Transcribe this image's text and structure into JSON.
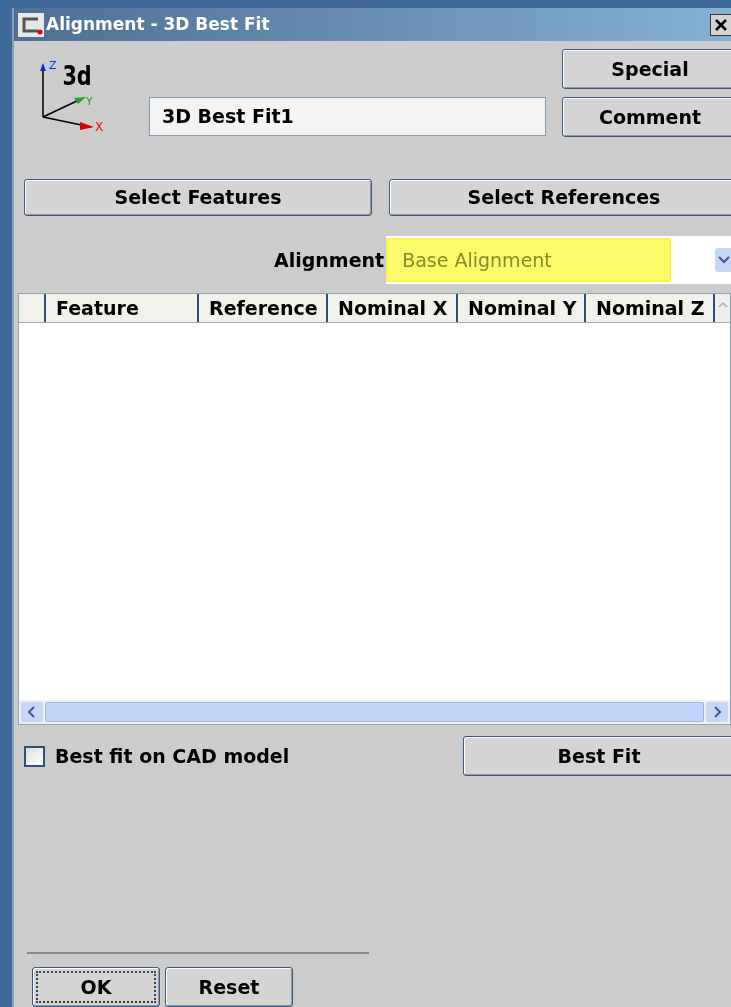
{
  "window": {
    "title": "Alignment - 3D Best Fit"
  },
  "axis_icon": {
    "label": "3d",
    "z": "Z",
    "y": "Y",
    "x": "X"
  },
  "name_field": {
    "value": "3D Best Fit1"
  },
  "side_buttons": [
    "Special",
    "Comment"
  ],
  "select_buttons": [
    "Select Features",
    "Select References"
  ],
  "alignment": {
    "label": "Alignment",
    "value": "Base Alignment",
    "highlighted": true
  },
  "table": {
    "columns": [
      "Feature",
      "Reference",
      "Nominal X",
      "Nominal Y",
      "Nominal Z"
    ]
  },
  "cad_checkbox": {
    "label": "Best fit on CAD model",
    "checked": false
  },
  "best_fit_button": "Best Fit",
  "footer_buttons": [
    {
      "label": "OK",
      "focused": true
    },
    {
      "label": "Reset",
      "focused": false
    }
  ]
}
